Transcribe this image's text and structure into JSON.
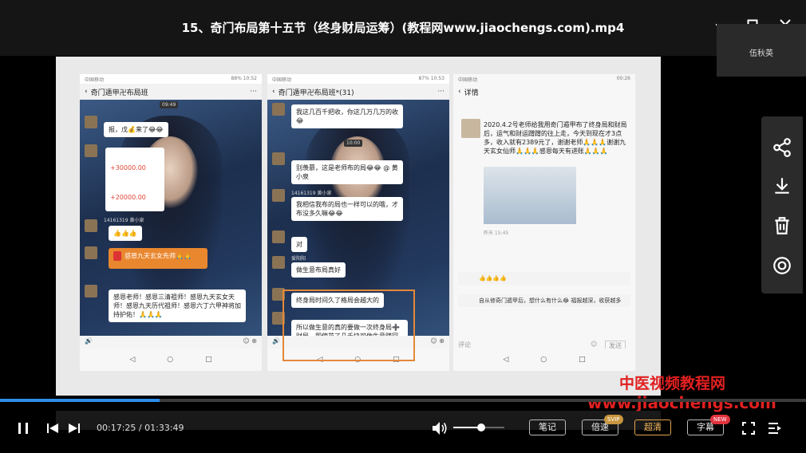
{
  "window": {
    "title": "15、奇门布局第十五节（终身财局运筹）(教程网www.jiaochengs.com).mp4",
    "user_name": "伍秋英"
  },
  "side_tools": [
    {
      "name": "share-icon"
    },
    {
      "name": "download-icon"
    },
    {
      "name": "delete-icon"
    },
    {
      "name": "target-icon"
    }
  ],
  "video": {
    "phone1": {
      "status_left": "中国移动",
      "status_right": "88% 10:52",
      "header": "奇门遁甲卍布局班",
      "time_chip": "09:49",
      "bubble1": "报，戊💰来了😂😂",
      "transfer1": "+30000.00",
      "transfer2": "+20000.00",
      "sender": "14161319 黄小泉",
      "bubble2": "👍👍👍",
      "redpacket": "感恩九天玄女先师🙏🙏",
      "bubble3": "感恩老师！感恩三清祖师！感恩九天玄女天师！感恩九天历代祖师！感恩六丁六甲神将加持护佑！🙏🙏🙏"
    },
    "phone2": {
      "status_left": "中国移动",
      "status_right": "87% 10:53",
      "header": "奇门遁甲卍布局班*(31)",
      "bubble1": "我这几百千把收，你这几万几万的收😂",
      "time_chip": "10:00",
      "bubble2": "别羡慕，这是老师布的局😂😂 @ 黄小泉",
      "sender": "14161319 黄小泉",
      "bubble3": "我相信我布的局也一样可以的哦，才布没多久嘛😂😂",
      "bubble4": "对",
      "sender2": "爱阳阳",
      "bubble5": "做生意布局真好",
      "bubble6": "终身局时间久了格局会越大的",
      "bubble7": "所以做生意的真的要做一次终身局➕财局，即使花了几千块可做生意赚回来的不止这些"
    },
    "phone3": {
      "status_left": "中国移动",
      "status_right": "00:26",
      "header": "详情",
      "text": "2020.4.2号老师给我用奇门遁甲布了终身局和财局后，运气和财运蹭蹭的往上走，今天到现在才3点多，收入就有2389元了，谢谢老师🙏🙏🙏谢谢九天玄女仙师🙏🙏🙏感恩每天有进账🙏🙏🙏",
      "time": "昨天 15:45",
      "comment1": "👍👍👍👍",
      "comment2": "自从修奇门遁甲后，想什么有什么😂 福报越深，收获越多",
      "comment_placeholder": "评论",
      "send": "发送"
    },
    "watermark_line1": "中医视频教程网",
    "watermark_line2": "www.jiaochengs.com"
  },
  "player": {
    "progress": 0.198,
    "current_time": "00:17:25",
    "total_time": "01:33:49",
    "time_separator": "/",
    "volume": 0.55,
    "notes_label": "笔记",
    "speed_label": "倍速",
    "speed_badge": "SVIP",
    "quality_label": "超清",
    "subtitle_label": "字幕",
    "subtitle_badge": "NEW"
  }
}
